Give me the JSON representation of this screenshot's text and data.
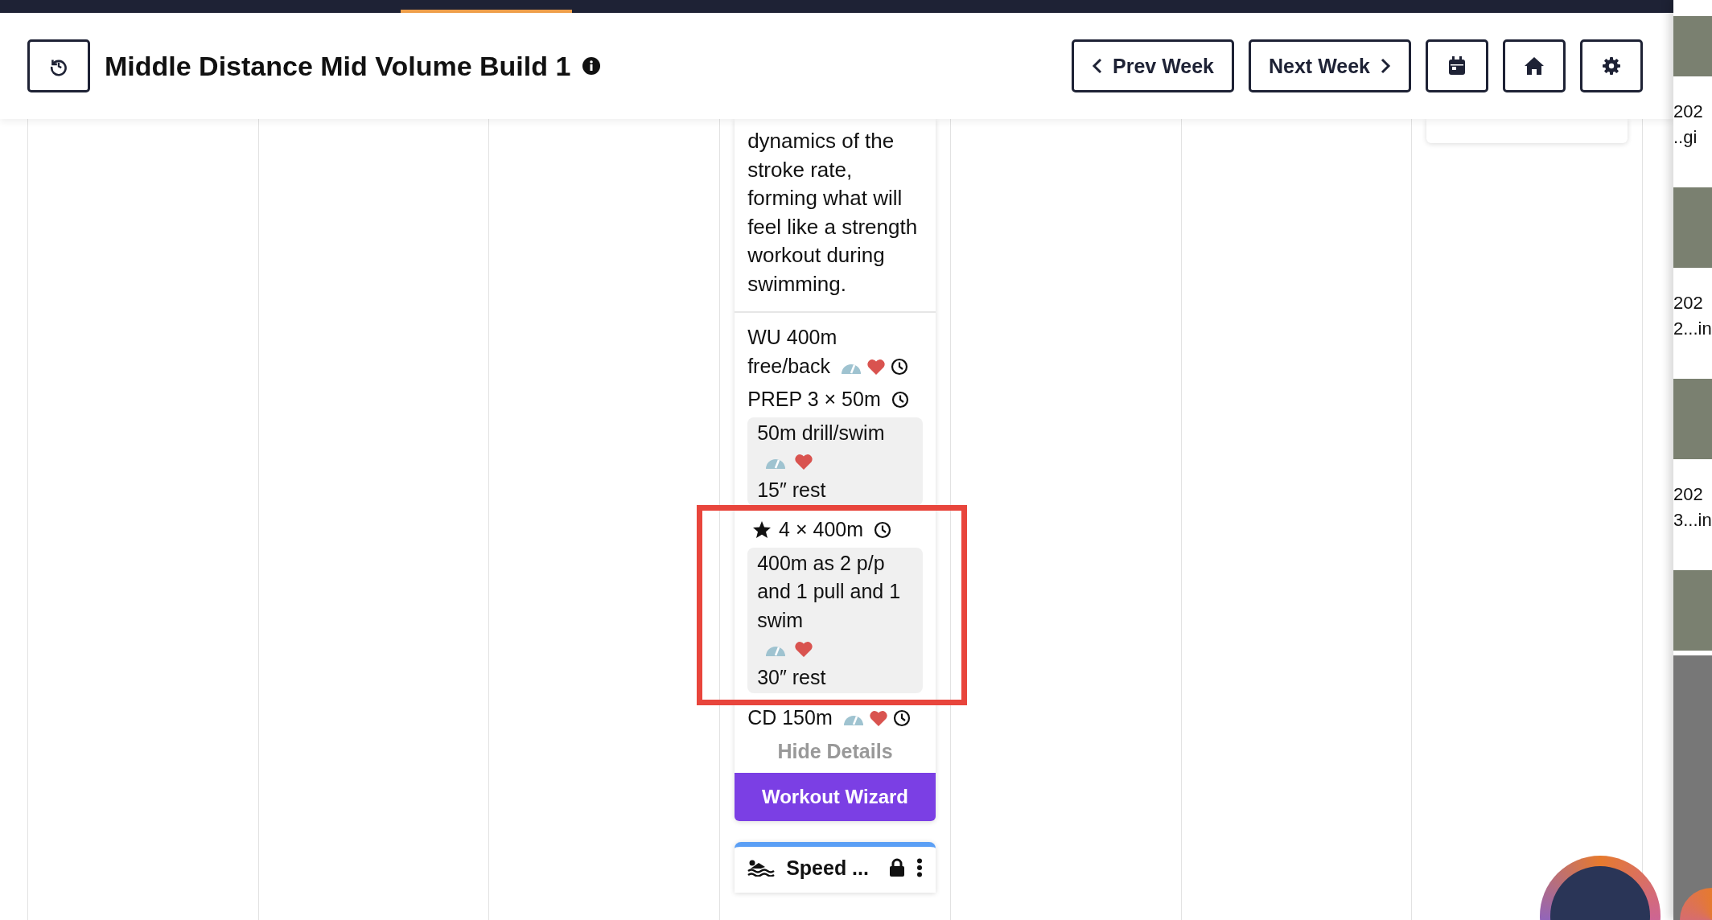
{
  "header": {
    "title": "Middle Distance Mid Volume Build 1",
    "buttons": [
      {
        "kind": "prev",
        "label": "Prev Week"
      },
      {
        "kind": "next",
        "label": "Next Week"
      },
      {
        "kind": "calendar"
      },
      {
        "kind": "home"
      },
      {
        "kind": "settings"
      }
    ]
  },
  "workout": {
    "description": "dynamics of the stroke rate, forming what will feel like a strength workout during swimming.",
    "steps": [
      {
        "kind": "step",
        "text": "WU 400m free/back",
        "pace": true,
        "heart": true,
        "timer": true
      },
      {
        "kind": "set",
        "text": "PREP 3 × 50m",
        "highlighted": false,
        "starred": false,
        "timer": true,
        "items": [
          {
            "text": "50m drill/swim",
            "pace": true,
            "heart": true,
            "rest": "15″ rest"
          }
        ]
      },
      {
        "kind": "set",
        "text": "4 × 400m",
        "highlighted": true,
        "starred": true,
        "timer": true,
        "items": [
          {
            "text": "400m as 2 p/p and 1 pull and 1 swim",
            "pace": true,
            "heart": true,
            "rest": "30″ rest"
          }
        ]
      },
      {
        "kind": "step",
        "text": "CD 150m",
        "pace": true,
        "heart": true,
        "timer": true
      }
    ],
    "details_toggle": "Hide Details",
    "wizard_button": "Workout Wizard"
  },
  "next_workout": {
    "title": "Speed ...",
    "locked": true
  },
  "side_panel": {
    "items": [
      {
        "line1": "202",
        "line2": "..gi"
      },
      {
        "line1": "202",
        "line2": "2...in"
      },
      {
        "line1": "202",
        "line2": "3...in"
      }
    ]
  }
}
